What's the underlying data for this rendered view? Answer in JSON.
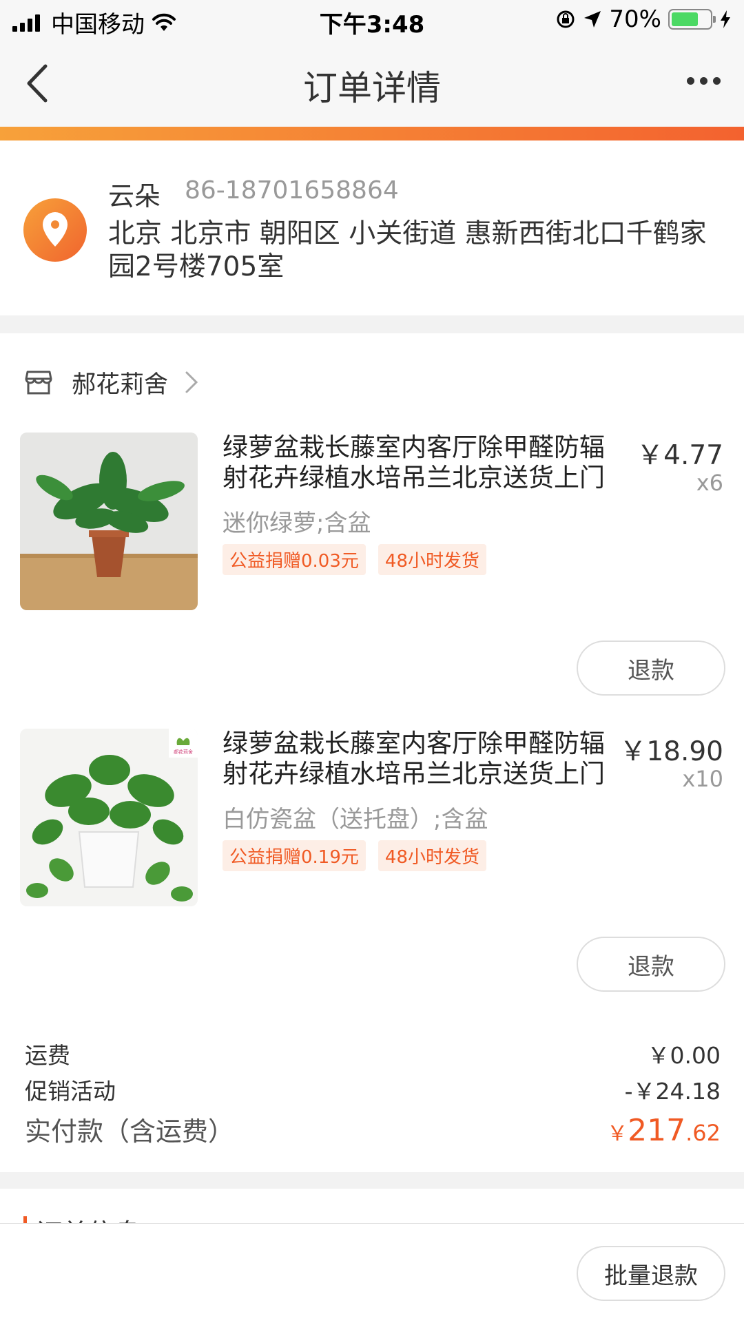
{
  "status_bar": {
    "carrier": "中国移动",
    "time": "下午3:48",
    "battery": "70%",
    "battery_level": 0.7
  },
  "nav": {
    "title": "订单详情"
  },
  "address": {
    "name": "云朵",
    "phone": "86-18701658864",
    "detail": "北京 北京市 朝阳区 小关街道 惠新西街北口千鹤家园2号楼705室"
  },
  "shop": {
    "name": "郝花莉舍"
  },
  "products": [
    {
      "title": "绿萝盆栽长藤室内客厅除甲醛防辐射花卉绿植水培吊兰北京送货上门",
      "price": "￥4.77",
      "qty": "x6",
      "sku": "迷你绿萝;含盆",
      "tags": [
        "公益捐赠0.03元",
        "48小时发货"
      ],
      "refund_label": "退款"
    },
    {
      "title": "绿萝盆栽长藤室内客厅除甲醛防辐射花卉绿植水培吊兰北京送货上门",
      "price": "￥18.90",
      "qty": "x10",
      "sku": "白仿瓷盆（送托盘）;含盆",
      "tags": [
        "公益捐赠0.19元",
        "48小时发货"
      ],
      "refund_label": "退款",
      "image_badge": "郝花莉舍"
    }
  ],
  "summary": {
    "shipping_label": "运费",
    "shipping_value": "￥0.00",
    "promo_label": "促销活动",
    "promo_value": "-￥24.18",
    "total_label": "实付款（含运费）",
    "total_yen": "￥",
    "total_int": "217",
    "total_dec": ".62"
  },
  "order_info": {
    "title": "订单信息"
  },
  "bottom": {
    "batch_refund_label": "批量退款"
  },
  "colors": {
    "accent": "#f05a24",
    "gradient_start": "#f7a13a",
    "gradient_end": "#f3622f"
  }
}
